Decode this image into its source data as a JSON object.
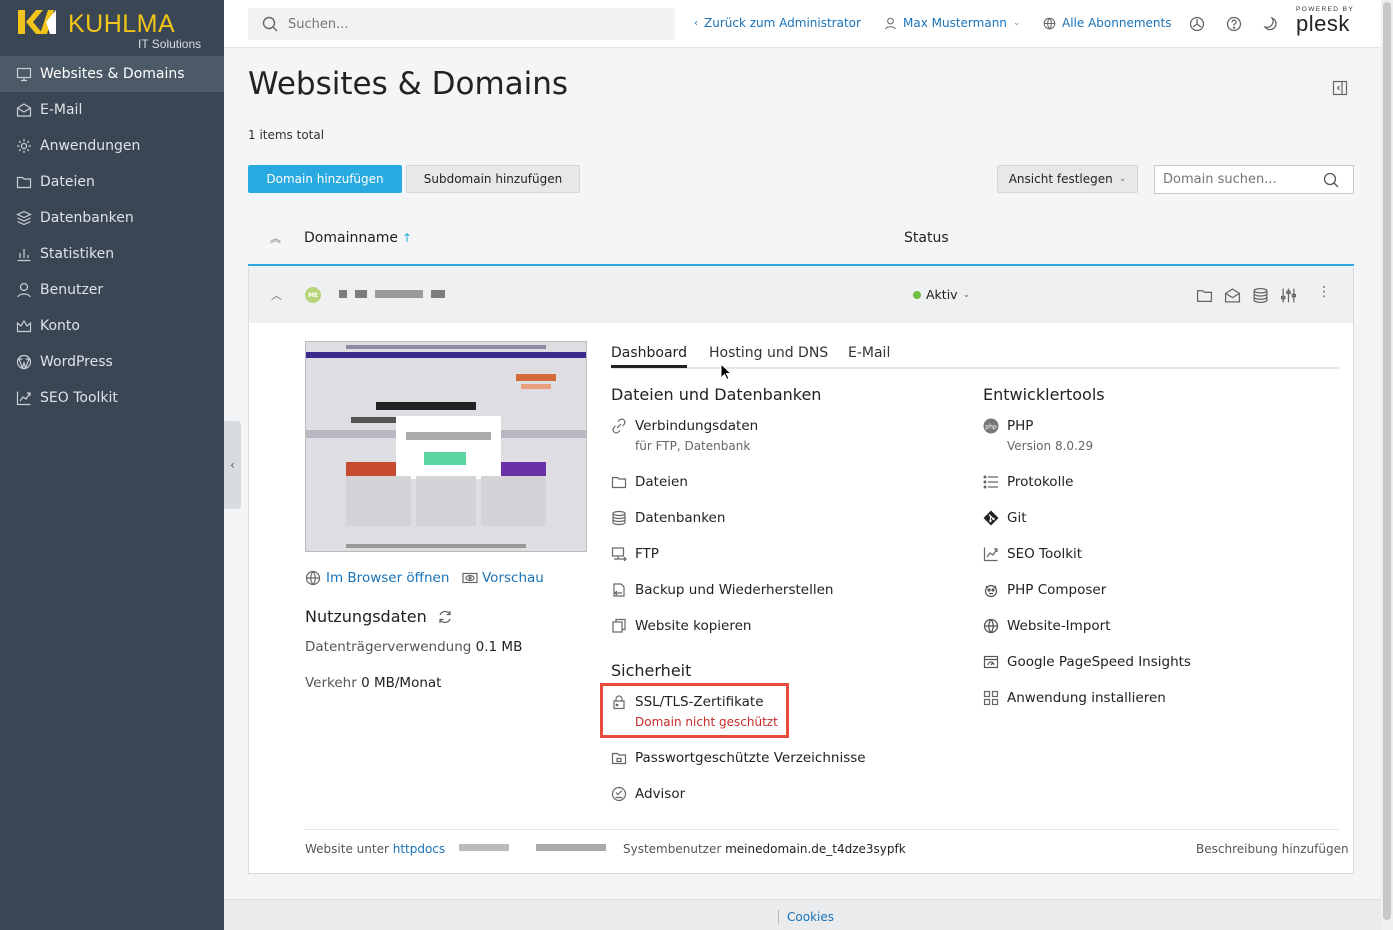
{
  "brand": {
    "logo_text": "KUHLMA",
    "logo_sub": "IT Solutions",
    "accent": "#f0c419"
  },
  "sidebar": {
    "items": [
      {
        "label": "Websites & Domains",
        "icon": "monitor-icon",
        "active": true
      },
      {
        "label": "E-Mail",
        "icon": "envelope-icon"
      },
      {
        "label": "Anwendungen",
        "icon": "gear-icon"
      },
      {
        "label": "Dateien",
        "icon": "folder-icon"
      },
      {
        "label": "Datenbanken",
        "icon": "database-icon"
      },
      {
        "label": "Statistiken",
        "icon": "bar-chart-icon"
      },
      {
        "label": "Benutzer",
        "icon": "user-icon"
      },
      {
        "label": "Konto",
        "icon": "crown-icon"
      },
      {
        "label": "WordPress",
        "icon": "wordpress-icon"
      },
      {
        "label": "SEO Toolkit",
        "icon": "seo-chart-icon"
      }
    ],
    "collapse_glyph": "‹"
  },
  "header": {
    "search_placeholder": "Suchen...",
    "back_link": "Zurück zum Administrator",
    "user_name": "Max Mustermann",
    "subscriptions": "Alle Abonnements",
    "powered_by": "POWERED BY",
    "product": "plesk"
  },
  "main": {
    "title": "Websites & Domains",
    "items_total": "1 items total",
    "add_domain_label": "Domain hinzufügen",
    "add_subdomain_label": "Subdomain hinzufügen",
    "view_label": "Ansicht festlegen",
    "domain_search_placeholder": "Domain suchen...",
    "col_domain": "Domainname",
    "col_status": "Status",
    "sort_glyph": "↑"
  },
  "domain": {
    "avatar_text": "ME",
    "status": "Aktiv",
    "open_browser": "Im Browser öffnen",
    "preview": "Vorschau",
    "usage_title": "Nutzungsdaten",
    "disk_label": "Datenträgerverwendung",
    "disk_value": "0.1 MB",
    "traffic_label": "Verkehr",
    "traffic_value": "0 MB/Monat",
    "tabs": [
      "Dashboard",
      "Hosting und DNS",
      "E-Mail"
    ],
    "files_section": "Dateien und Datenbanken",
    "files_items": [
      {
        "label": "Verbindungsdaten",
        "sub": "für FTP, Datenbank"
      },
      {
        "label": "Dateien"
      },
      {
        "label": "Datenbanken"
      },
      {
        "label": "FTP"
      },
      {
        "label": "Backup und Wiederherstellen"
      },
      {
        "label": "Website kopieren"
      }
    ],
    "security_section": "Sicherheit",
    "security_items": [
      {
        "label": "SSL/TLS-Zertifikate",
        "sub": "Domain nicht geschützt"
      },
      {
        "label": "Passwortgeschützte Verzeichnisse"
      },
      {
        "label": "Advisor"
      }
    ],
    "dev_section": "Entwicklertools",
    "dev_items": [
      {
        "label": "PHP",
        "sub": "Version 8.0.29"
      },
      {
        "label": "Protokolle"
      },
      {
        "label": "Git"
      },
      {
        "label": "SEO Toolkit"
      },
      {
        "label": "PHP Composer"
      },
      {
        "label": "Website-Import"
      },
      {
        "label": "Google PageSpeed Insights"
      },
      {
        "label": "Anwendung installieren"
      }
    ],
    "footer_website_label": "Website unter",
    "footer_docroot": "httpdocs",
    "footer_sysuser_label": "Systembenutzer",
    "footer_sysuser": "meinedomain.de_t4dze3sypfk",
    "footer_add_desc": "Beschreibung hinzufügen"
  },
  "bottom": {
    "cookies": "Cookies"
  }
}
